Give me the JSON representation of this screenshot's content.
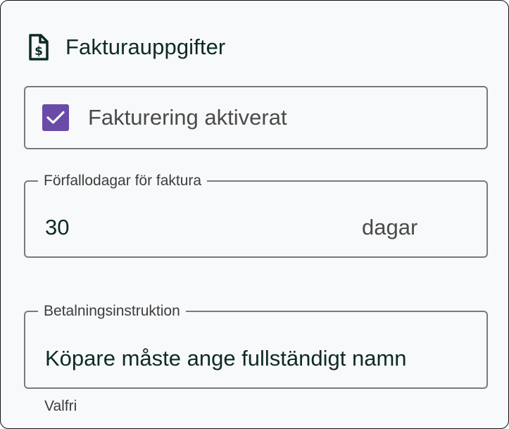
{
  "section": {
    "title": "Fakturauppgifter",
    "icon": "invoice-dollar-icon"
  },
  "invoicing_toggle": {
    "label": "Fakturering aktiverat",
    "checked": true,
    "color": "#6a4ba8"
  },
  "due_days": {
    "legend": "Förfallodagar för faktura",
    "value": "30",
    "unit": "dagar"
  },
  "payment_instruction": {
    "legend": "Betalningsinstruktion",
    "value": "Köpare måste ange fullständigt namn",
    "helper": "Valfri"
  },
  "colors": {
    "text_dark": "#0d2a26",
    "border": "#7a7a7a",
    "card_bg": "#f8f9fb"
  }
}
